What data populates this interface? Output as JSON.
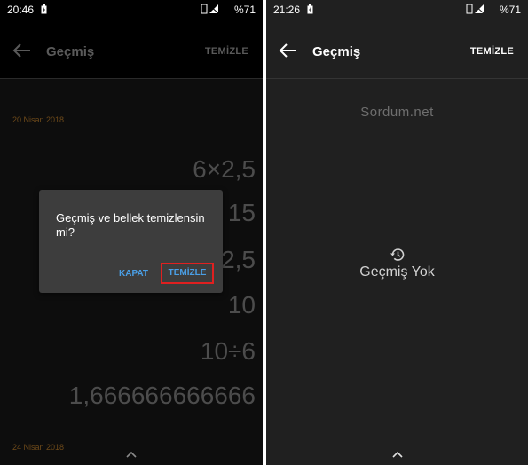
{
  "left": {
    "status": {
      "time": "20:46",
      "battery": "%71"
    },
    "appbar": {
      "title": "Geçmiş",
      "action": "TEMİZLE"
    },
    "history": {
      "date1": "20 Nisan 2018",
      "expressions": [
        "6×2,5",
        "15",
        "2,5",
        "10",
        "10÷6",
        "1,666666666666"
      ],
      "date2": "24 Nisan 2018"
    },
    "dialog": {
      "message": "Geçmiş ve bellek temizlensin mi?",
      "cancel": "KAPAT",
      "confirm": "TEMİZLE"
    }
  },
  "right": {
    "status": {
      "time": "21:26",
      "battery": "%71"
    },
    "appbar": {
      "title": "Geçmiş",
      "action": "TEMİZLE"
    },
    "watermark": "Sordum.net",
    "empty": {
      "icon": "history-icon",
      "text": "Geçmiş Yok"
    }
  },
  "colors": {
    "highlight_border": "#e02020",
    "dialog_button": "#4a9fe6",
    "date_text": "#6e4a1a"
  }
}
